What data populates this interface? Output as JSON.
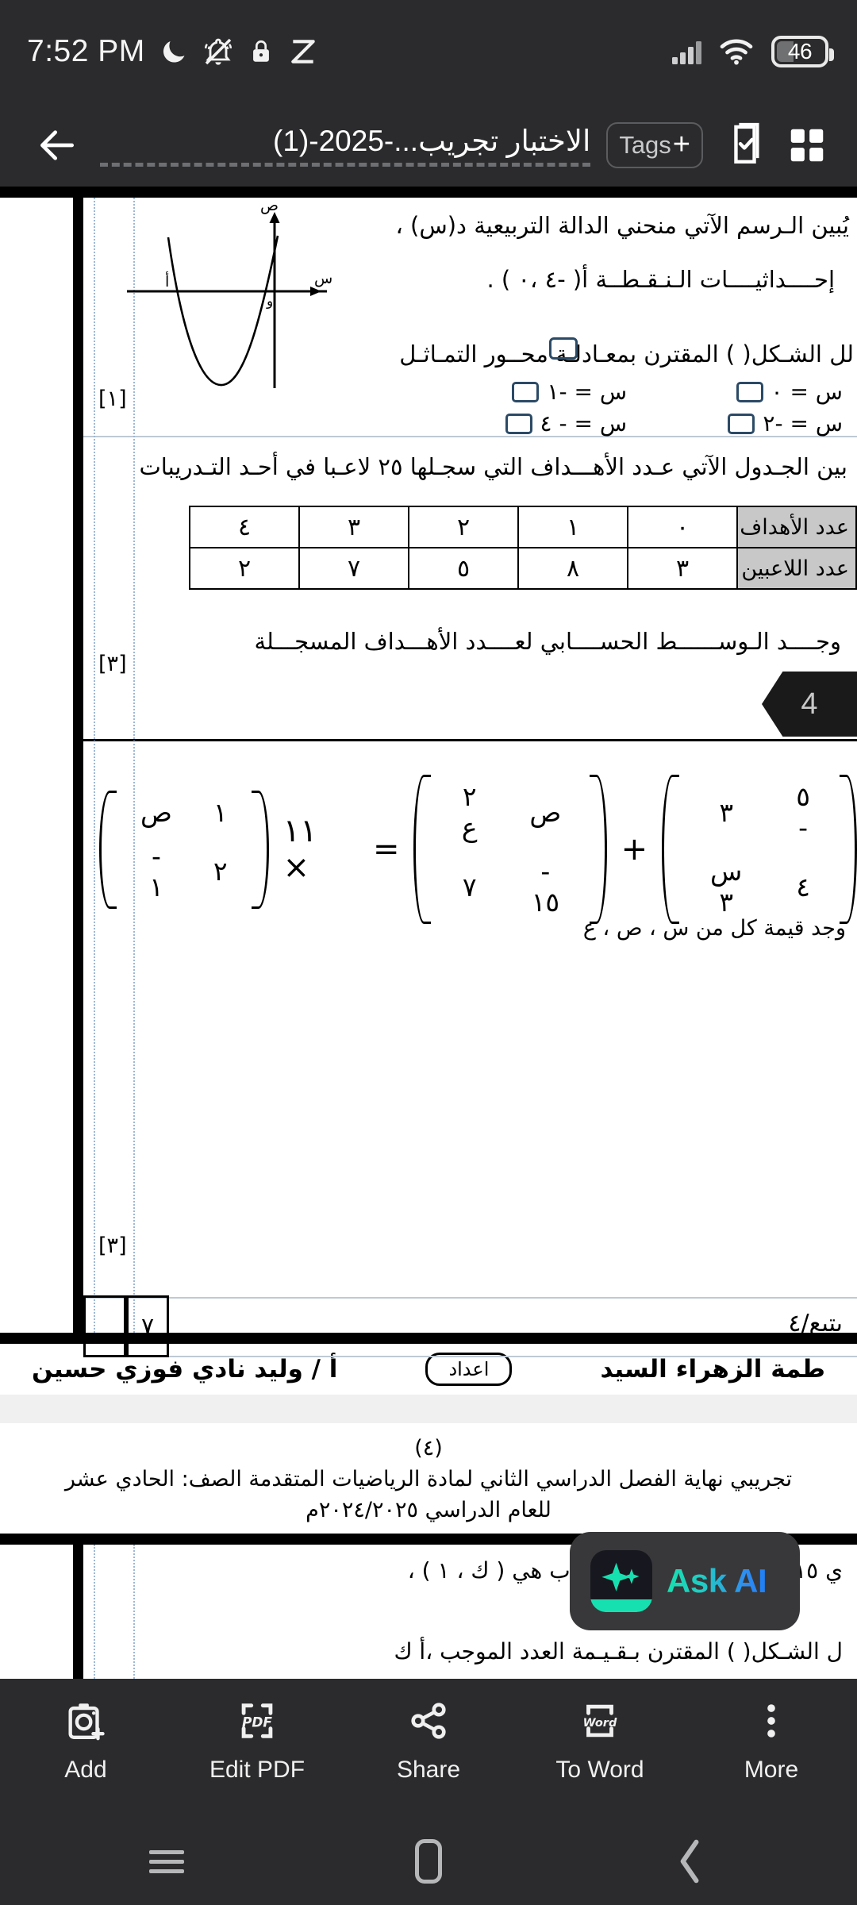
{
  "status_bar": {
    "time": "7:52 PM",
    "left_icons": [
      "moon-icon",
      "notifications-muted-icon",
      "lock-icon",
      "capcut-icon"
    ],
    "battery_percent": "46",
    "right_icons": [
      "signal-icon",
      "wifi-icon",
      "battery-icon"
    ]
  },
  "app_bar": {
    "back_icon": "back-arrow-icon",
    "document_title": "الاختبار تجريب...-2025-(1)",
    "tags_label": "Tags",
    "tags_plus": "+",
    "select_icon": "checkbox-document-icon",
    "grid_icon": "grid-view-icon"
  },
  "document": {
    "page3": {
      "q1_line1": "يُبين الـرسم الآتي منحني الدالة التربيعية د(س) ،",
      "q1_line2": "إحــــداثيــــات الـنـقـطــة  أ( -٤ ،٠ )  .",
      "q1_line3": "لل الشـكل(    ) المقترن بمعـادلـة محــور التمـاثـل",
      "q1_opt_right_1": "س = ٠",
      "q1_opt_right_2": "س = -٢",
      "q1_opt_left_1": "س = -١",
      "q1_opt_left_2": "س = - ٤",
      "q1_marks": "[١]",
      "graph": {
        "x_axis_label": "س",
        "y_axis_label": "ص",
        "origin_label": "و",
        "point_label": "أ"
      },
      "q2_text": "بين الجـدول الآتي  عـدد الأهـــداف التي سجـلها ٢٥ لاعـبا في أحـد التـدريبات",
      "table": {
        "row1_header": "عدد الأهداف",
        "row1": [
          "٤",
          "٣",
          "٢",
          "١",
          "٠"
        ],
        "row2_header": "عدد اللاعبين",
        "row2": [
          "٢",
          "٧",
          "٥",
          "٨",
          "٣"
        ]
      },
      "q2_prompt": "وجــــد الـوســــــط الحســــابي لعــــدد الأهـــداف المسجـــلة",
      "q2_marks": "[٣]",
      "page_tag": "4",
      "matrix": {
        "m1": [
          [
            "٥ -",
            "٣"
          ],
          [
            "٤",
            "س ٣"
          ]
        ],
        "plus": "+",
        "m2": [
          [
            "ص",
            "٢ ع"
          ],
          [
            "- ١٥",
            "٧"
          ]
        ],
        "equals": "=",
        "scalar": "١١ ×",
        "m3": [
          [
            "ص",
            "١"
          ],
          [
            "- ١",
            "٢"
          ]
        ]
      },
      "q3_prompt": "وجد قيمة كل من س ، ص ، ع",
      "q3_marks": "[٣]",
      "footer_note": "يتبع/٤",
      "footer_mark": "٧",
      "signature_right": "طمة الزهراء السيد",
      "signature_chip": "اعداد",
      "signature_left": "أ / وليد نادي فوزي حسين"
    },
    "page4": {
      "page_number": "(٤)",
      "head_line1": "تجريبي نهاية الفصل الدراسي الثاني لمادة الرياضيات المتقدمة الصف: الحادي عشر",
      "head_line2": "للعام الدراسي ٢٠٢٤/٢٠٢٥م",
      "q_line1": "ي ١٥ و احداثيات النقطتين أ ، ب هي ( ك ، ١ ) ،",
      "q_line2": "ل الشـكل(   ) المقترن بـقـيـمة العدد الموجب ،أ ك"
    }
  },
  "ask_ai": {
    "label": "Ask AI",
    "icon": "ai-sparkle-icon"
  },
  "toolbar": {
    "items": [
      {
        "label": "Add",
        "icon": "camera-add-icon"
      },
      {
        "label": "Edit PDF",
        "icon": "pdf-icon"
      },
      {
        "label": "Share",
        "icon": "share-icon"
      },
      {
        "label": "To Word",
        "icon": "word-icon"
      },
      {
        "label": "More",
        "icon": "more-vertical-icon"
      }
    ]
  },
  "nav_bar": {
    "recents_icon": "recents-icon",
    "home_icon": "home-icon",
    "back_icon": "nav-back-icon"
  },
  "colors": {
    "chrome": "#2b2b2d",
    "accent_teal": "#17e0b0",
    "accent_blue": "#1f7ef5",
    "table_header": "#c8c8c8"
  }
}
